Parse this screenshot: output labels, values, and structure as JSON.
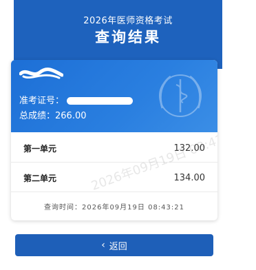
{
  "header": {
    "subtitle": "2026年医师资格考试",
    "title": "查询结果"
  },
  "card": {
    "exam_no_label": "准考证号：",
    "total_label": "总成绩：",
    "total_value": "266.00",
    "rows": [
      {
        "label": "第一单元",
        "value": "132.00"
      },
      {
        "label": "第二单元",
        "value": "134.00"
      }
    ],
    "query_time": "查询时间：2026年09月19日 08:43:21",
    "watermark": "2026年09月19日 08:43:21"
  },
  "back_button": {
    "label": "返回"
  },
  "colors": {
    "header_blue": "#1e62bd",
    "card_blue": "#2a7fe0",
    "button_blue": "#1e5fb8"
  }
}
